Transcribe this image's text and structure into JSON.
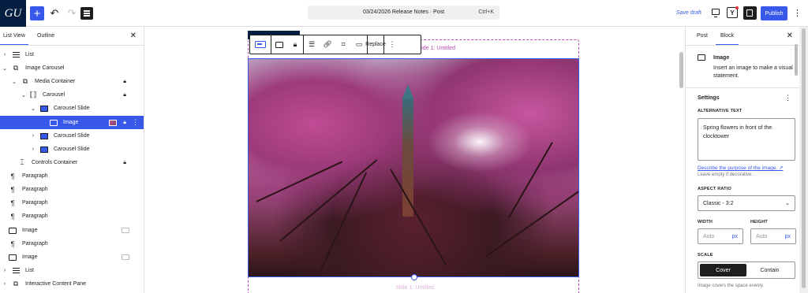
{
  "header": {
    "logo_text": "GU",
    "document_title": "03/24/2026 Release Notes · Post",
    "shortcut": "Ctrl+K",
    "save_draft": "Save draft",
    "publish": "Publish",
    "yoast_letter": "Y",
    "add_icon": "plus-icon",
    "undo_icon": "undo-icon",
    "redo_icon": "redo-icon",
    "accent_color": "#3858e9"
  },
  "left_panel": {
    "tabs": [
      "List View",
      "Outline"
    ],
    "active_tab": "List View",
    "items": [
      {
        "label": "List"
      },
      {
        "label": "Image Carousel"
      },
      {
        "label": "Media Container"
      },
      {
        "label": "Carousel"
      },
      {
        "label": "Carousel Slide"
      },
      {
        "label": "Image"
      },
      {
        "label": "Carousel Slide"
      },
      {
        "label": "Carousel Slide"
      },
      {
        "label": "Controls Container"
      },
      {
        "label": "Paragraph"
      },
      {
        "label": "Paragraph"
      },
      {
        "label": "Paragraph"
      },
      {
        "label": "Paragraph"
      },
      {
        "label": "Image"
      },
      {
        "label": "Paragraph"
      },
      {
        "label": "Image"
      },
      {
        "label": "List"
      },
      {
        "label": "Interactive Content Pane"
      }
    ]
  },
  "canvas": {
    "slide_label_top": "Slide 1: Untitled",
    "slide_label_bottom": "Slide 1: Untitled",
    "toolbar_replace": "Replace",
    "image_alt": "Spring flowers in front of the clocktower"
  },
  "right_panel": {
    "tabs": [
      "Post",
      "Block"
    ],
    "active_tab": "Block",
    "block_name": "Image",
    "block_description": "Insert an image to make a visual statement.",
    "settings_title": "Settings",
    "alt_label": "ALTERNATIVE TEXT",
    "alt_value": "Spring flowers in front of the clocktower",
    "alt_link": "Describe the purpose of the image.",
    "alt_help": "Leave empty if decorative.",
    "aspect_label": "ASPECT RATIO",
    "aspect_value": "Classic - 3:2",
    "width_label": "WIDTH",
    "height_label": "HEIGHT",
    "width_placeholder": "Auto",
    "height_placeholder": "Auto",
    "unit": "px",
    "scale_label": "SCALE",
    "scale_options": [
      "Cover",
      "Contain"
    ],
    "scale_selected": "Cover",
    "scale_help": "Image covers the space evenly."
  }
}
